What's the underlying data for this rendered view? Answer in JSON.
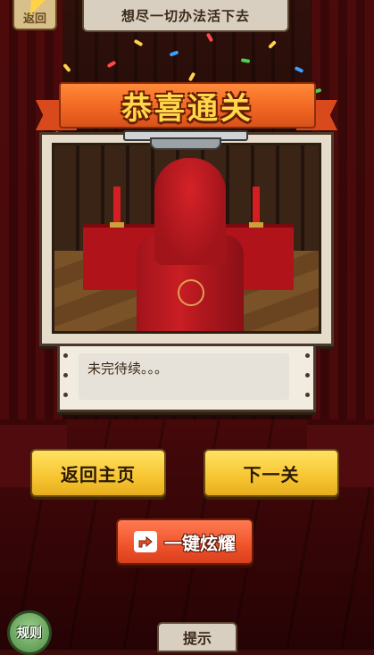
{
  "top_bar": {
    "back_label": "返回",
    "level_title": "想尽一切办法活下去"
  },
  "result_card": {
    "banner_title": "恭喜通关",
    "note_text": "未完待续。。。"
  },
  "actions": {
    "home_label": "返回主页",
    "next_label": "下一关",
    "share_label": "一键炫耀",
    "share_icon": "share-icon"
  },
  "bottom": {
    "rules_label": "规则",
    "hint_label": "提示"
  },
  "colors": {
    "banner": "#f26722",
    "banner_text": "#ffd84a",
    "primary_button": "#f7c531",
    "share_button": "#f0532b"
  }
}
